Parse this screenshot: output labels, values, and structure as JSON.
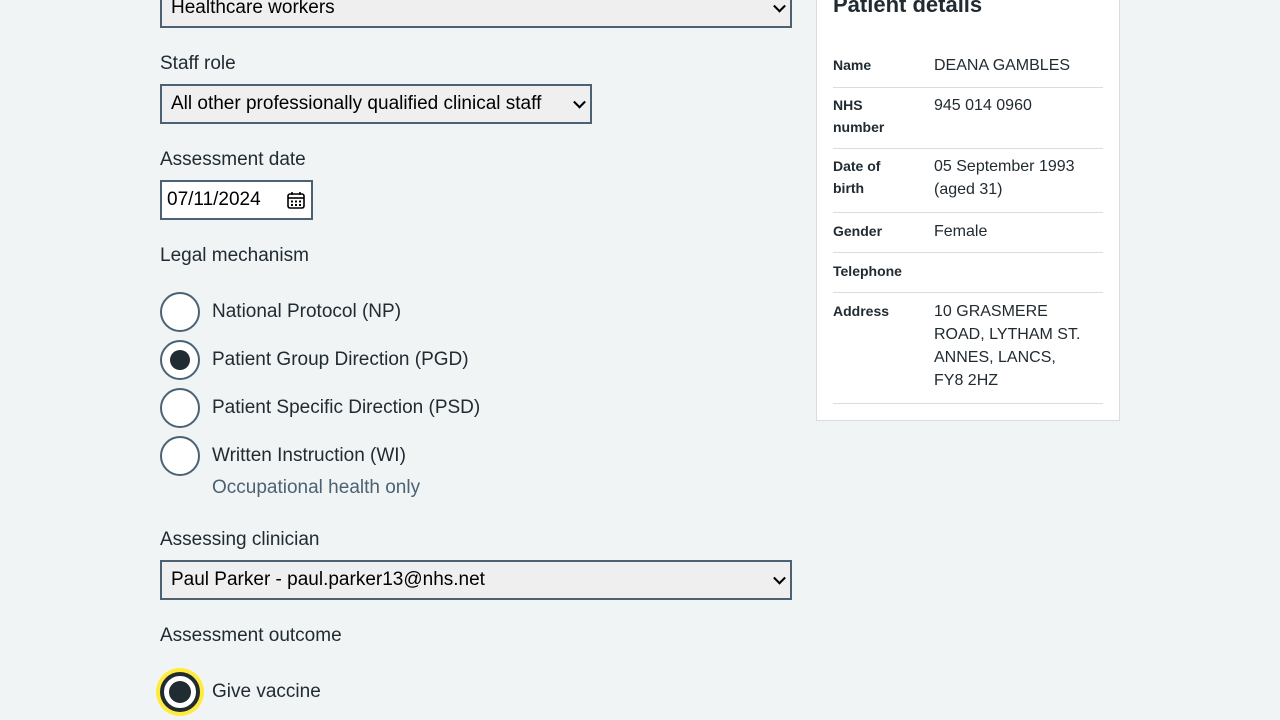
{
  "form": {
    "staff_group_value": "Healthcare workers",
    "staff_role_label": "Staff role",
    "staff_role_value": "All other professionally qualified clinical staff",
    "assessment_date_label": "Assessment date",
    "assessment_date_value": "07/11/2024",
    "legal_mechanism_label": "Legal mechanism",
    "legal_mechanisms": [
      {
        "label": "National Protocol (NP)",
        "checked": false
      },
      {
        "label": "Patient Group Direction (PGD)",
        "checked": true
      },
      {
        "label": "Patient Specific Direction (PSD)",
        "checked": false
      },
      {
        "label": "Written Instruction (WI)",
        "checked": false,
        "hint": "Occupational health only"
      }
    ],
    "assessing_clinician_label": "Assessing clinician",
    "assessing_clinician_value": "Paul Parker - paul.parker13@nhs.net",
    "assessment_outcome_label": "Assessment outcome",
    "outcome_options": [
      {
        "label": "Give vaccine",
        "checked": true,
        "focused": true
      }
    ]
  },
  "patient": {
    "title": "Patient details",
    "rows": [
      {
        "key": "Name",
        "value": "DEANA GAMBLES"
      },
      {
        "key": "NHS number",
        "value": "945 014 0960"
      },
      {
        "key": "Date of birth",
        "value": "05 September 1993 (aged 31)"
      },
      {
        "key": "Gender",
        "value": "Female"
      },
      {
        "key": "Telephone",
        "value": ""
      },
      {
        "key": "Address",
        "value": "10 GRASMERE ROAD, LYTHAM ST. ANNES, LANCS, FY8 2HZ"
      }
    ]
  },
  "icons": {
    "calendar": "calendar-icon",
    "dropdown": "chevron-down-icon"
  },
  "colors": {
    "background": "#f0f4f5",
    "text": "#212b32",
    "border": "#4c6272",
    "hint": "#4c6272",
    "focus": "#ffeb3b"
  }
}
